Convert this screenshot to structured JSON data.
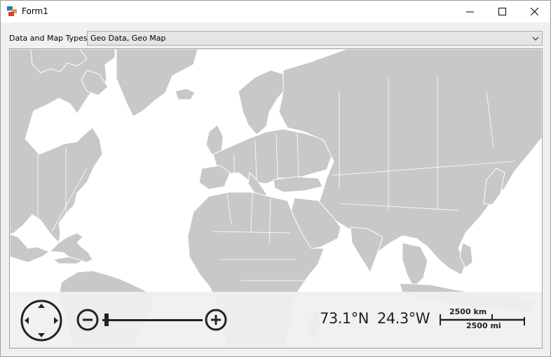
{
  "window": {
    "title": "Form1"
  },
  "controls": {
    "minimize": "minimize-icon",
    "maximize": "maximize-icon",
    "close": "close-icon"
  },
  "form": {
    "label": "Data and Map Types",
    "combo_value": "Geo Data, Geo Map"
  },
  "map": {
    "latitude": "73.1°N",
    "longitude": "24.3°W",
    "scale_km": "2500 km",
    "scale_mi": "2500 mi",
    "land_color": "#c8c8c8",
    "border_color": "#ffffff"
  },
  "icons": {
    "navigation": "navigation-pad-icon",
    "zoom_out": "zoom-out-icon",
    "zoom_in": "zoom-in-icon"
  }
}
